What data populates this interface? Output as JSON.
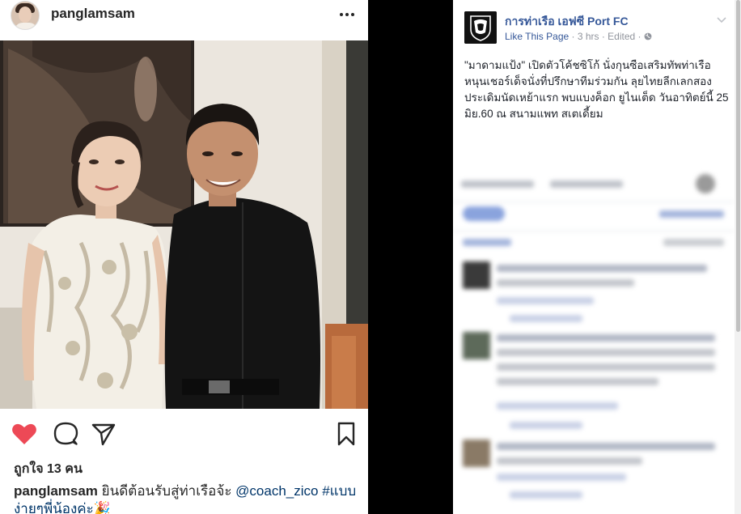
{
  "instagram": {
    "username": "panglamsam",
    "likes": "ถูกใจ 13 คน",
    "caption_user": "panglamsam",
    "caption_text": " ยินดีต้อนรับสู่ท่าเรือจ้ะ ",
    "caption_tag1": "@coach_zico",
    "caption_tag2": " #แบบง่ายๆพี่น้องค่ะ",
    "caption_emoji": "🎉",
    "icons": [
      "heart-icon",
      "comment-icon",
      "share-icon",
      "bookmark-icon",
      "more-icon"
    ],
    "colors": {
      "heart": "#ed4956",
      "text": "#262626",
      "tag": "#003569"
    }
  },
  "facebook": {
    "page_name": "การท่าเรือ เอฟซี Port FC",
    "like_page": "Like This Page",
    "meta_time": " · 3 hrs · Edited · ",
    "post_text": "\"มาดามแป้ง\" เปิดตัวโค้ชซิโก้ นั่งกุนซือเสริมทัพท่าเรือ หนุนเชอร์เด็จนั่งที่ปรึกษาทีมร่วมกัน ลุยไทยลีกเลกสองประเดิมนัดเหย้าแรก พบแบงค็อก ยูไนเต็ด วันอาทิตย์นี้ 25 มิย.60 ณ สนามแพท สเตเดี้ยม",
    "colors": {
      "link": "#365899",
      "meta": "#90949c",
      "text": "#1d2129"
    }
  }
}
